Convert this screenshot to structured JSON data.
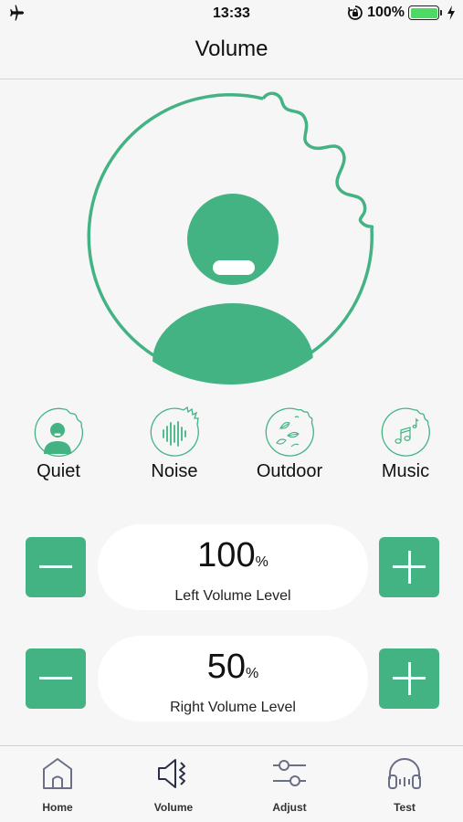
{
  "status_bar": {
    "time": "13:33",
    "battery_percent": "100%",
    "battery_level": 1.0,
    "icons": [
      "airplane-icon",
      "rotation-lock-icon",
      "battery-icon",
      "charging-bolt-icon"
    ]
  },
  "nav": {
    "title": "Volume"
  },
  "hero": {
    "icon": "person-listening-icon",
    "accent_color": "#43b384"
  },
  "modes": [
    {
      "label": "Quiet",
      "icon": "quiet-mode-icon"
    },
    {
      "label": "Noise",
      "icon": "noise-mode-icon"
    },
    {
      "label": "Outdoor",
      "icon": "outdoor-mode-icon"
    },
    {
      "label": "Music",
      "icon": "music-mode-icon"
    }
  ],
  "left_volume": {
    "value": "100",
    "unit": "%",
    "label": "Left Volume Level",
    "decrease_icon": "minus-icon",
    "increase_icon": "plus-icon"
  },
  "right_volume": {
    "value": "50",
    "unit": "%",
    "label": "Right Volume Level",
    "decrease_icon": "minus-icon",
    "increase_icon": "plus-icon"
  },
  "tabs": [
    {
      "label": "Home",
      "icon": "home-icon",
      "active": false
    },
    {
      "label": "Volume",
      "icon": "speaker-icon",
      "active": true
    },
    {
      "label": "Adjust",
      "icon": "sliders-icon",
      "active": false
    },
    {
      "label": "Test",
      "icon": "headphones-icon",
      "active": false
    }
  ],
  "colors": {
    "accent": "#43b384",
    "background": "#f6f6f6",
    "pill": "#ffffff",
    "tab_icon": "#6b6f86",
    "tab_icon_active": "#2b2f45"
  }
}
